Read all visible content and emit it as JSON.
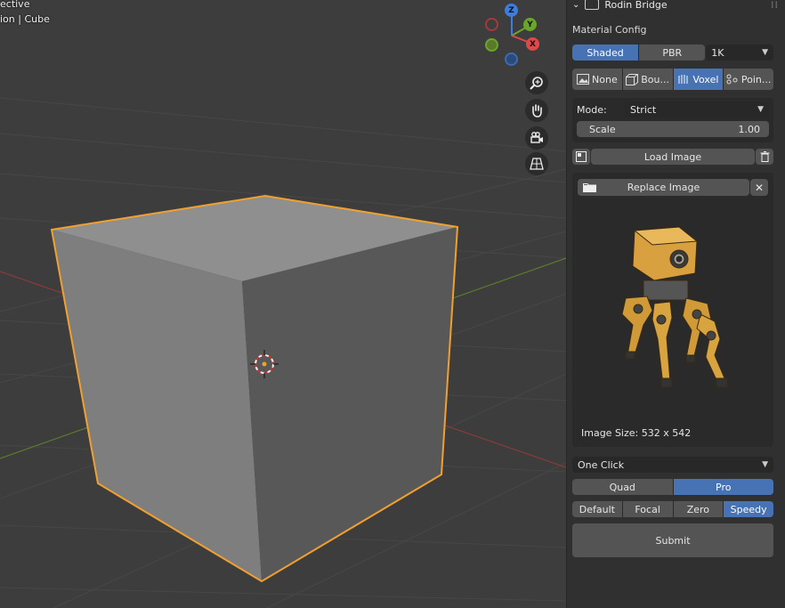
{
  "viewport": {
    "title_partial": "ective",
    "subtitle_partial": "ion | Cube",
    "gizmo": {
      "x": "X",
      "y": "Y",
      "z": "Z"
    },
    "nav_icons": [
      "zoom-icon",
      "hand-pan-icon",
      "camera-icon",
      "grid-perspective-icon"
    ]
  },
  "panel": {
    "header": "Rodin Bridge",
    "section": "Material Config",
    "material_modes": [
      {
        "label": "Shaded",
        "active": true
      },
      {
        "label": "PBR",
        "active": false
      }
    ],
    "resolution": "1K",
    "condition_modes": [
      {
        "label": "None",
        "icon": "image-icon",
        "active": false
      },
      {
        "label": "Bou...",
        "icon": "bbox-icon",
        "active": false
      },
      {
        "label": "Voxel",
        "icon": "voxel-icon",
        "active": true
      },
      {
        "label": "Poin...",
        "icon": "points-icon",
        "active": false
      }
    ],
    "mode_label": "Mode:",
    "mode_value": "Strict",
    "scale_label": "Scale",
    "scale_value": "1.00",
    "load_image": "Load Image",
    "replace_image": "Replace Image",
    "image_size": "Image Size: 532 x 542",
    "generate_mode": "One Click",
    "tier": [
      {
        "label": "Quad",
        "active": false
      },
      {
        "label": "Pro",
        "active": true
      }
    ],
    "quality": [
      {
        "label": "Default",
        "active": false
      },
      {
        "label": "Focal",
        "active": false
      },
      {
        "label": "Zero",
        "active": false
      },
      {
        "label": "Speedy",
        "active": true
      }
    ],
    "submit": "Submit"
  },
  "colors": {
    "accent": "#4772b3",
    "selection": "#f0a030",
    "x_axis": "#e04848",
    "y_axis": "#6aa62a",
    "z_axis": "#3d7de0"
  }
}
